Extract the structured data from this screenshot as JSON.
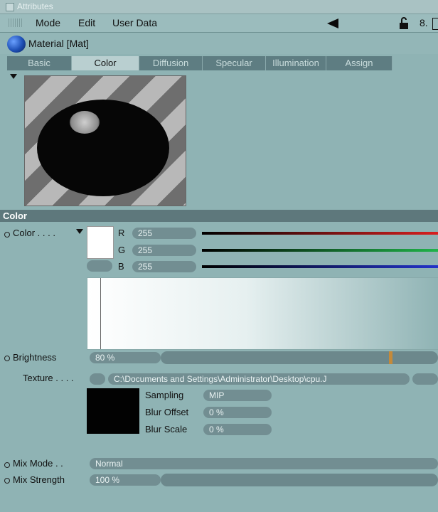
{
  "window": {
    "title": "Attributes"
  },
  "menubar": {
    "items": [
      "Mode",
      "Edit",
      "User Data"
    ],
    "extra": "8."
  },
  "material": {
    "name": "Material [Mat]"
  },
  "tabs": [
    {
      "label": "Basic",
      "active": false
    },
    {
      "label": "Color",
      "active": true
    },
    {
      "label": "Diffusion",
      "active": false
    },
    {
      "label": "Specular",
      "active": false
    },
    {
      "label": "Illumination",
      "active": false
    },
    {
      "label": "Assign",
      "active": false
    }
  ],
  "color_section": {
    "title": "Color",
    "color_label": "Color . . . .",
    "r_label": "R",
    "r_value": "255",
    "g_label": "G",
    "g_value": "255",
    "b_label": "B",
    "b_value": "255",
    "brightness_label": "Brightness",
    "brightness_value": "80 %",
    "texture_label": "Texture . . . .",
    "texture_path": "C:\\Documents and Settings\\Administrator\\Desktop\\cpu.J",
    "sampling_label": "Sampling",
    "sampling_value": "MIP",
    "blur_offset_label": "Blur Offset",
    "blur_offset_value": "0 %",
    "blur_scale_label": "Blur Scale",
    "blur_scale_value": "0 %",
    "mix_mode_label": "Mix Mode . .",
    "mix_mode_value": "Normal",
    "mix_strength_label": "Mix Strength",
    "mix_strength_value": "100 %"
  },
  "colors": {
    "accent": "#5e787c",
    "panel": "#8fb3b4",
    "red": "#d81f1f",
    "green": "#20b34a",
    "blue": "#2333c9"
  }
}
